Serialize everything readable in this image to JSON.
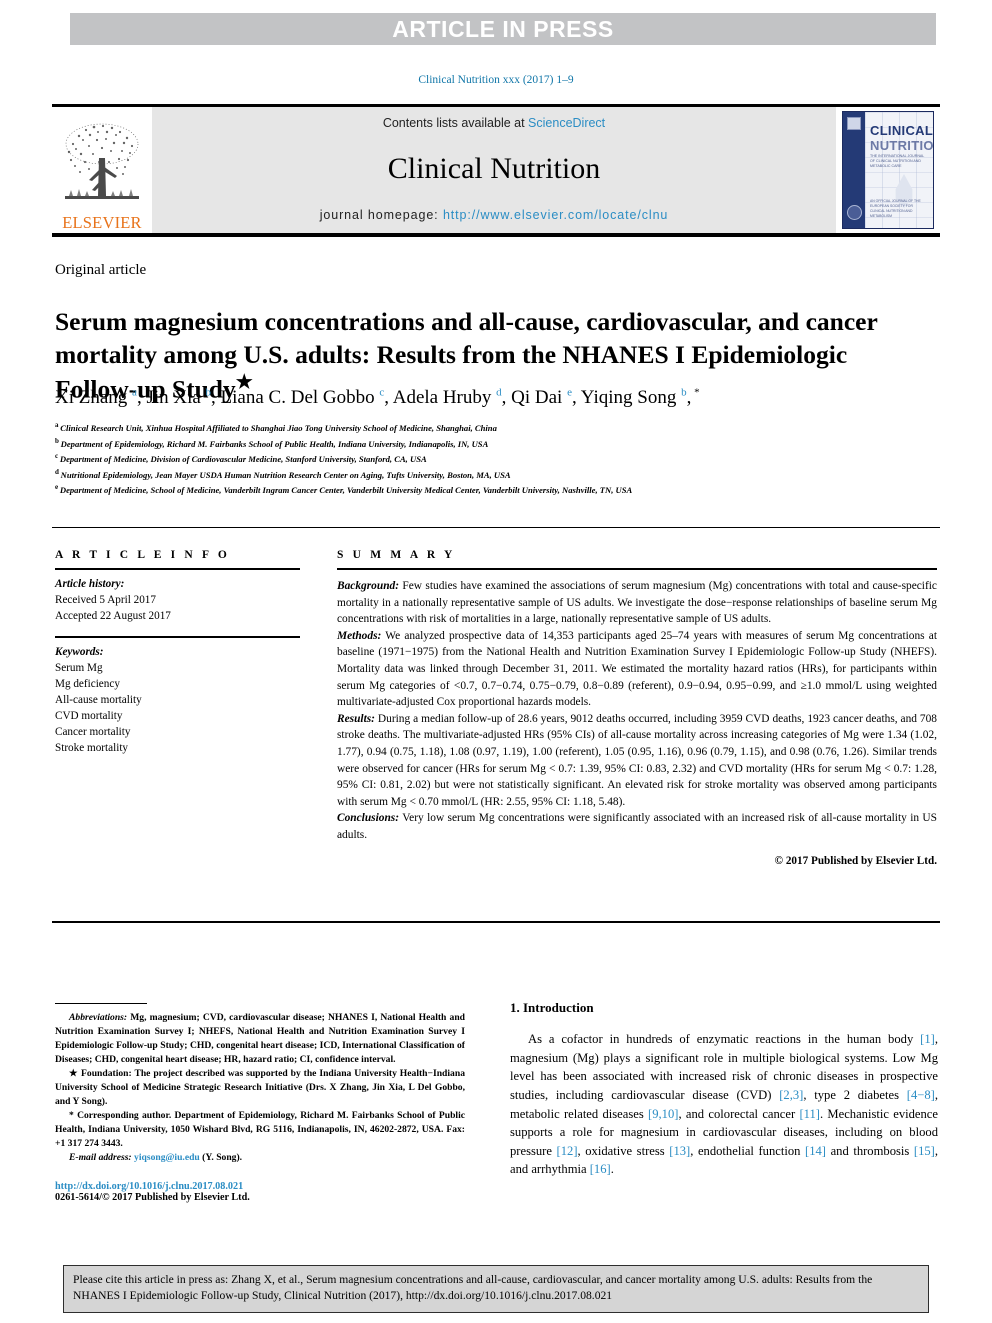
{
  "banner": {
    "text": "ARTICLE IN PRESS"
  },
  "running_head": "Clinical Nutrition xxx (2017) 1–9",
  "masthead": {
    "publisher": "ELSEVIER",
    "contents_prefix": "Contents lists available at ",
    "contents_link": "ScienceDirect",
    "journal_name": "Clinical Nutrition",
    "homepage_prefix": "journal homepage: ",
    "homepage_url": "http://www.elsevier.com/locate/clnu",
    "cover": {
      "title_line1": "CLINICAL",
      "title_line2": "NUTRITION",
      "subtitle": "THE INTERNATIONAL JOURNAL OF CLINICAL NUTRITION AND METABOLIC CARE",
      "footer": "AN OFFICIAL JOURNAL OF THE EUROPEAN SOCIETY FOR CLINICAL NUTRITION AND METABOLISM"
    }
  },
  "article": {
    "type": "Original article",
    "title": "Serum magnesium concentrations and all-cause, cardiovascular, and cancer mortality among U.S. adults: Results from the NHANES I Epidemiologic Follow-up Study",
    "title_marker": "★",
    "authors": [
      {
        "name": "Xi Zhang",
        "marks": "a",
        "sep": ", "
      },
      {
        "name": "Jin Xia",
        "marks": "b",
        "sep": ", "
      },
      {
        "name": "Liana C. Del Gobbo",
        "marks": "c",
        "sep": ", "
      },
      {
        "name": "Adela Hruby",
        "marks": "d",
        "sep": ", "
      },
      {
        "name": "Qi Dai",
        "marks": "e",
        "sep": ", "
      },
      {
        "name": "Yiqing Song",
        "marks": "b",
        "sep": "",
        "corresponding": "*"
      }
    ],
    "affiliations": [
      {
        "mark": "a",
        "text": "Clinical Research Unit, Xinhua Hospital Affiliated to Shanghai Jiao Tong University School of Medicine, Shanghai, China"
      },
      {
        "mark": "b",
        "text": "Department of Epidemiology, Richard M. Fairbanks School of Public Health, Indiana University, Indianapolis, IN, USA"
      },
      {
        "mark": "c",
        "text": "Department of Medicine, Division of Cardiovascular Medicine, Stanford University, Stanford, CA, USA"
      },
      {
        "mark": "d",
        "text": "Nutritional Epidemiology, Jean Mayer USDA Human Nutrition Research Center on Aging, Tufts University, Boston, MA, USA"
      },
      {
        "mark": "e",
        "text": "Department of Medicine, School of Medicine, Vanderbilt Ingram Cancer Center, Vanderbilt University Medical Center, Vanderbilt University, Nashville, TN, USA"
      }
    ]
  },
  "article_info": {
    "heading": "A R T I C L E  I N F O",
    "history_label": "Article history:",
    "received": "Received 5 April 2017",
    "accepted": "Accepted 22 August 2017",
    "keywords_label": "Keywords:",
    "keywords": [
      "Serum Mg",
      "Mg deficiency",
      "All-cause mortality",
      "CVD mortality",
      "Cancer mortality",
      "Stroke mortality"
    ]
  },
  "summary": {
    "heading": "S U M M A R Y",
    "background_label": "Background:",
    "background": " Few studies have examined the associations of serum magnesium (Mg) concentrations with total and cause-specific mortality in a nationally representative sample of US adults. We investigate the dose−response relationships of baseline serum Mg concentrations with risk of mortalities in a large, nationally representative sample of US adults.",
    "methods_label": "Methods:",
    "methods": " We analyzed prospective data of 14,353 participants aged 25–74 years with measures of serum Mg concentrations at baseline (1971−1975) from the National Health and Nutrition Examination Survey I Epidemiologic Follow-up Study (NHEFS). Mortality data was linked through December 31, 2011. We estimated the mortality hazard ratios (HRs), for participants within serum Mg categories of <0.7, 0.7−0.74, 0.75−0.79, 0.8−0.89 (referent), 0.9−0.94, 0.95−0.99, and ≥1.0 mmol/L using weighted multivariate-adjusted Cox proportional hazards models.",
    "results_label": "Results:",
    "results": " During a median follow-up of 28.6 years, 9012 deaths occurred, including 3959 CVD deaths, 1923 cancer deaths, and 708 stroke deaths. The multivariate-adjusted HRs (95% CIs) of all-cause mortality across increasing categories of Mg were 1.34 (1.02, 1.77), 0.94 (0.75, 1.18), 1.08 (0.97, 1.19), 1.00 (referent), 1.05 (0.95, 1.16), 0.96 (0.79, 1.15), and 0.98 (0.76, 1.26). Similar trends were observed for cancer (HRs for serum Mg < 0.7: 1.39, 95% CI: 0.83, 2.32) and CVD mortality (HRs for serum Mg < 0.7: 1.28, 95% CI: 0.81, 2.02) but were not statistically significant. An elevated risk for stroke mortality was observed among participants with serum Mg < 0.70 mmol/L (HR: 2.55, 95% CI: 1.18, 5.48).",
    "conclusions_label": "Conclusions:",
    "conclusions": " Very low serum Mg concentrations were significantly associated with an increased risk of all-cause mortality in US adults.",
    "copyright": "© 2017 Published by Elsevier Ltd."
  },
  "footnotes": {
    "abbreviations_label": "Abbreviations:",
    "abbreviations": " Mg, magnesium; CVD, cardiovascular disease; NHANES I, National Health and Nutrition Examination Survey I; NHEFS, National Health and Nutrition Examination Survey I Epidemiologic Follow-up Study; CHD, congenital heart disease; ICD, International Classification of Diseases; CHD, congenital heart disease; HR, hazard ratio; CI, confidence interval.",
    "foundation_marker": "★",
    "foundation_label": "Foundation:",
    "foundation": " The project described was supported by the Indiana University Health−Indiana University School of Medicine Strategic Research Initiative (Drs. X Zhang, Jin Xia, L Del Gobbo, and Y Song).",
    "corresponding_marker": "*",
    "corresponding": " Corresponding author. Department of Epidemiology, Richard M. Fairbanks School of Public Health, Indiana University, 1050 Wishard Blvd, RG 5116, Indianapolis, IN, 46202-2872, USA. Fax: +1 317 274 3443.",
    "email_label": "E-mail address:",
    "email": "yiqsong@iu.edu",
    "email_owner": " (Y. Song).",
    "doi": "http://dx.doi.org/10.1016/j.clnu.2017.08.021",
    "issn": "0261-5614/© 2017 Published by Elsevier Ltd."
  },
  "introduction": {
    "heading": "1. Introduction",
    "paragraph_parts": [
      {
        "t": "As a cofactor in hundreds of enzymatic reactions in the human body "
      },
      {
        "r": "[1]"
      },
      {
        "t": ", magnesium (Mg) plays a significant role in multiple biological systems. Low Mg level has been associated with increased risk of chronic diseases in prospective studies, including cardiovascular disease (CVD) "
      },
      {
        "r": "[2,3]"
      },
      {
        "t": ", type 2 diabetes "
      },
      {
        "r": "[4−8]"
      },
      {
        "t": ", metabolic related diseases "
      },
      {
        "r": "[9,10]"
      },
      {
        "t": ", and colorectal cancer "
      },
      {
        "r": "[11]"
      },
      {
        "t": ". Mechanistic evidence supports a role for magnesium in cardiovascular diseases, including on blood pressure "
      },
      {
        "r": "[12]"
      },
      {
        "t": ", oxidative stress "
      },
      {
        "r": "[13]"
      },
      {
        "t": ", endothelial function "
      },
      {
        "r": "[14]"
      },
      {
        "t": " and thrombosis "
      },
      {
        "r": "[15]"
      },
      {
        "t": ", and arrhythmia "
      },
      {
        "r": "[16]"
      },
      {
        "t": "."
      }
    ]
  },
  "cite_box": {
    "text": "Please cite this article in press as: Zhang X, et al., Serum magnesium concentrations and all-cause, cardiovascular, and cancer mortality among U.S. adults: Results from the NHANES I Epidemiologic Follow-up Study, Clinical Nutrition (2017), http://dx.doi.org/10.1016/j.clnu.2017.08.021"
  },
  "colors": {
    "banner_bg": "#c2c3c5",
    "link": "#2b8dc4",
    "running_head": "#1076a8",
    "elsevier_orange": "#e8731b",
    "masthead_bg": "#e6e6e6",
    "cite_box_bg": "#d5d5d5"
  }
}
